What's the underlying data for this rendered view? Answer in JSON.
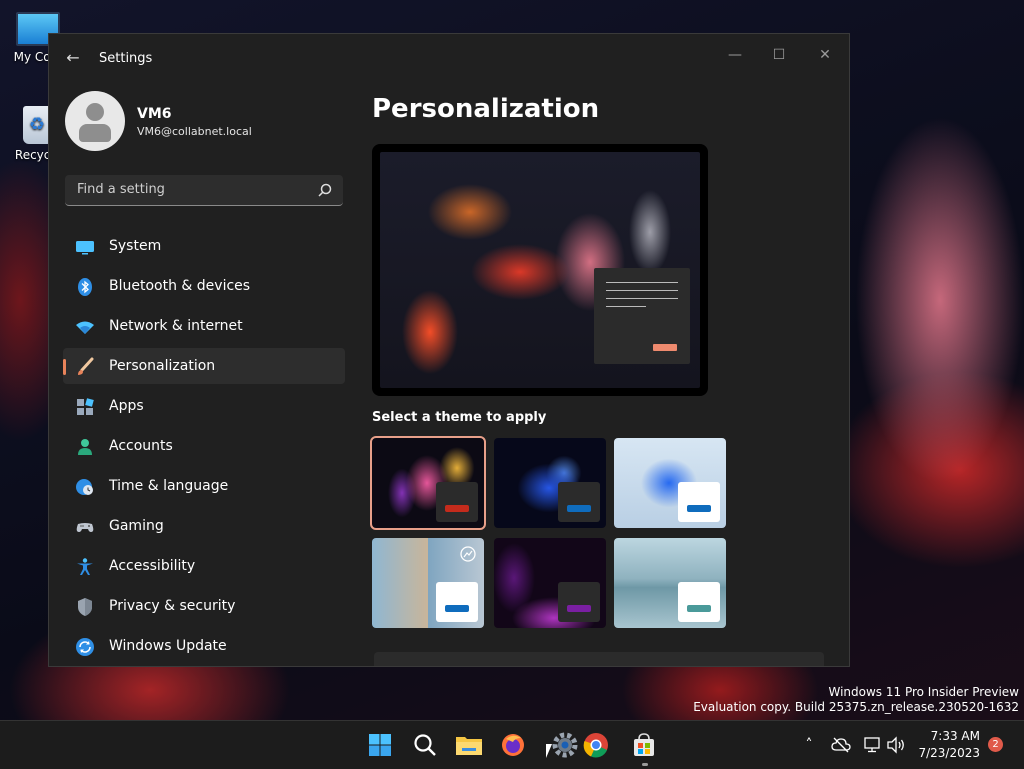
{
  "desktop": {
    "icons": [
      {
        "label": "My Com"
      },
      {
        "label": "Recycle"
      }
    ],
    "watermark": {
      "line1": "Windows 11 Pro Insider Preview",
      "line2": "Evaluation copy. Build 25375.zn_release.230520-1632"
    }
  },
  "window": {
    "title": "Settings",
    "back_icon": "back-arrow-icon",
    "controls": [
      "minimize-icon",
      "maximize-icon",
      "close-icon"
    ]
  },
  "profile": {
    "name": "VM6",
    "email": "VM6@collabnet.local"
  },
  "search": {
    "placeholder": "Find a setting",
    "value": ""
  },
  "nav": {
    "items": [
      {
        "label": "System",
        "icon": "system-icon",
        "selected": false
      },
      {
        "label": "Bluetooth & devices",
        "icon": "bluetooth-icon",
        "selected": false
      },
      {
        "label": "Network & internet",
        "icon": "wifi-icon",
        "selected": false
      },
      {
        "label": "Personalization",
        "icon": "brush-icon",
        "selected": true
      },
      {
        "label": "Apps",
        "icon": "apps-icon",
        "selected": false
      },
      {
        "label": "Accounts",
        "icon": "accounts-icon",
        "selected": false
      },
      {
        "label": "Time & language",
        "icon": "globe-clock-icon",
        "selected": false
      },
      {
        "label": "Gaming",
        "icon": "gamepad-icon",
        "selected": false
      },
      {
        "label": "Accessibility",
        "icon": "accessibility-icon",
        "selected": false
      },
      {
        "label": "Privacy & security",
        "icon": "shield-icon",
        "selected": false
      },
      {
        "label": "Windows Update",
        "icon": "update-icon",
        "selected": false
      }
    ]
  },
  "content": {
    "title": "Personalization",
    "themes_heading": "Select a theme to apply",
    "themes": [
      {
        "id": "theme-1",
        "accent": "#c42b1c",
        "card": "#2b2b2b",
        "selected": true
      },
      {
        "id": "theme-2",
        "accent": "#0f6cbd",
        "card": "#2b2b2b",
        "selected": false
      },
      {
        "id": "theme-3",
        "accent": "#0f6cbd",
        "card": "#ffffff",
        "selected": false
      },
      {
        "id": "theme-4",
        "accent": "#0f6cbd",
        "card": "#ffffff",
        "selected": false
      },
      {
        "id": "theme-5",
        "accent": "#7a1fa2",
        "card": "#2b2b2b",
        "selected": false
      },
      {
        "id": "theme-6",
        "accent": "#4a9a9a",
        "card": "#ffffff",
        "selected": false
      }
    ]
  },
  "taskbar": {
    "apps": [
      "start-icon",
      "search-icon",
      "file-explorer-icon",
      "firefox-icon",
      "settings-gear-icon",
      "chrome-icon",
      "store-icon"
    ],
    "tray": [
      "chevron-up-icon",
      "cloud-off-icon",
      "network-icon",
      "volume-icon"
    ],
    "time": "7:33 AM",
    "date": "7/23/2023",
    "notifications": "2"
  },
  "colors": {
    "accent": "#e8835a",
    "window_bg": "#202020",
    "taskbar_bg": "#1c1c1c"
  }
}
